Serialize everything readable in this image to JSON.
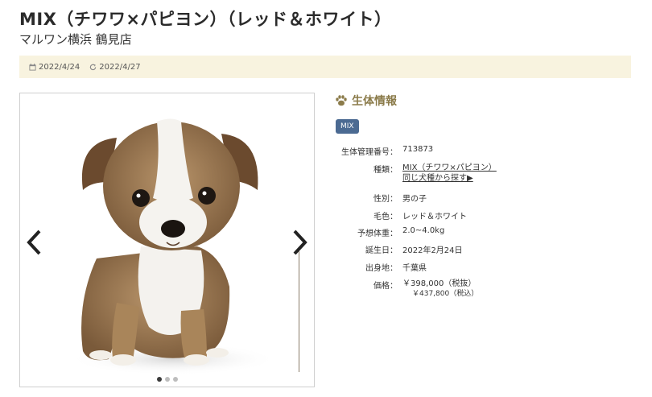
{
  "header": {
    "title": "MIX（チワワ×パピヨン）（レッド＆ホワイト）",
    "shop": "マルワン横浜 鶴見店"
  },
  "dates": {
    "posted": "2022/4/24",
    "updated": "2022/4/27",
    "posted_icon": "calendar-icon",
    "updated_icon": "refresh-icon"
  },
  "gallery": {
    "slide_count": 3,
    "active_slide": 1,
    "prev_icon": "chevron-left-icon",
    "next_icon": "chevron-right-icon"
  },
  "info": {
    "heading": "生体情報",
    "heading_icon": "paw-icon",
    "badge": "MIX",
    "rows": [
      {
        "label": "生体管理番号：",
        "value": "713873"
      },
      {
        "label": "種類：",
        "value": "MIX（チワワ×パピヨン）",
        "link2": "同じ犬種から探す▶"
      },
      {
        "label": "性別：",
        "value": "男の子"
      },
      {
        "label": "毛色：",
        "value": "レッド＆ホワイト"
      },
      {
        "label": "予想体重：",
        "value": "2.0~4.0kg"
      },
      {
        "label": "誕生日：",
        "value": "2022年2月24日"
      },
      {
        "label": "出身地：",
        "value": "千葉県"
      },
      {
        "label": "価格：",
        "value": "￥398,000（税抜）",
        "sub": "￥437,800（税込）"
      }
    ]
  },
  "colors": {
    "accent": "#8b7b4a",
    "badge_bg": "#4b6a92",
    "datebar_bg": "#f8f3df"
  }
}
